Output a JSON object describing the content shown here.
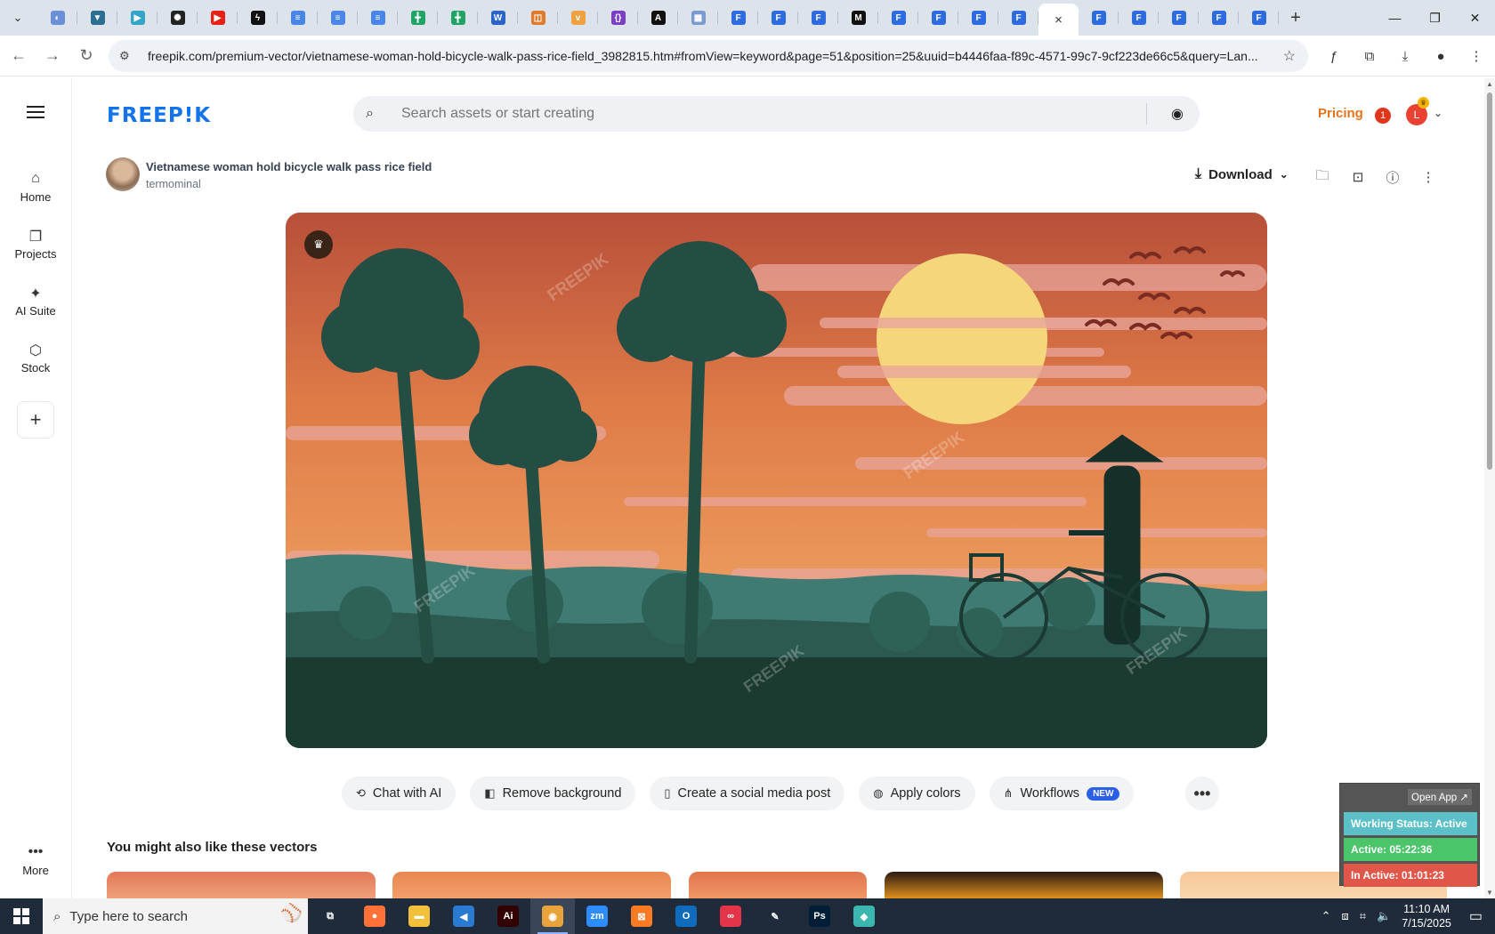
{
  "browser": {
    "active_tab_close": "×",
    "new_tab": "+",
    "url": "freepik.com/premium-vector/vietnamese-woman-hold-bicycle-walk-pass-rice-field_3982815.htm#fromView=keyword&page=51&position=25&uuid=b4446faa-f89c-4571-99c7-9cf223de66c5&query=Lan...",
    "tabs": [
      {
        "icon": "edge-like-icon",
        "color": "#6b8fd8",
        "glyph": "◐"
      },
      {
        "icon": "vpn-icon",
        "color": "#2c6e91",
        "glyph": "▼"
      },
      {
        "icon": "hex-icon",
        "color": "#35a4c9",
        "glyph": "▶"
      },
      {
        "icon": "chatgpt-icon",
        "color": "#222222",
        "glyph": "✺"
      },
      {
        "icon": "youtube-icon",
        "color": "#e62117",
        "glyph": "▶"
      },
      {
        "icon": "bolt-icon",
        "color": "#111111",
        "glyph": "ϟ"
      },
      {
        "icon": "docs-icon",
        "color": "#4a86e8",
        "glyph": "≡"
      },
      {
        "icon": "docs-icon",
        "color": "#4a86e8",
        "glyph": "≡"
      },
      {
        "icon": "docs-icon",
        "color": "#4a86e8",
        "glyph": "≡"
      },
      {
        "icon": "sheets-icon",
        "color": "#1fa463",
        "glyph": "╋"
      },
      {
        "icon": "sheets-icon",
        "color": "#1fa463",
        "glyph": "╋"
      },
      {
        "icon": "word-icon",
        "color": "#2b65c9",
        "glyph": "W"
      },
      {
        "icon": "orange-icon",
        "color": "#e07a2c",
        "glyph": "◫"
      },
      {
        "icon": "bird-icon",
        "color": "#f0a040",
        "glyph": "v"
      },
      {
        "icon": "braces-icon",
        "color": "#7a3fc4",
        "glyph": "{}"
      },
      {
        "icon": "a-icon",
        "color": "#111111",
        "glyph": "A"
      },
      {
        "icon": "grid-icon",
        "color": "#7a9ad0",
        "glyph": "▦"
      },
      {
        "icon": "forms-icon",
        "color": "#2d6cdf",
        "glyph": "F"
      },
      {
        "icon": "forms-icon",
        "color": "#2d6cdf",
        "glyph": "F"
      },
      {
        "icon": "forms-icon",
        "color": "#2d6cdf",
        "glyph": "F"
      },
      {
        "icon": "m-icon",
        "color": "#111111",
        "glyph": "M"
      },
      {
        "icon": "forms-icon",
        "color": "#2d6cdf",
        "glyph": "F"
      },
      {
        "icon": "forms-icon",
        "color": "#2d6cdf",
        "glyph": "F"
      },
      {
        "icon": "forms-icon",
        "color": "#2d6cdf",
        "glyph": "F"
      },
      {
        "icon": "forms-icon",
        "color": "#2d6cdf",
        "glyph": "F"
      }
    ],
    "tabs_after": [
      {
        "icon": "forms-icon",
        "color": "#2d6cdf",
        "glyph": "F"
      },
      {
        "icon": "forms-icon",
        "color": "#2d6cdf",
        "glyph": "F"
      },
      {
        "icon": "forms-icon",
        "color": "#2d6cdf",
        "glyph": "F"
      },
      {
        "icon": "forms-icon",
        "color": "#2d6cdf",
        "glyph": "F"
      },
      {
        "icon": "forms-icon",
        "color": "#2d6cdf",
        "glyph": "F"
      }
    ]
  },
  "nav": {
    "home": "Home",
    "projects": "Projects",
    "ai_suite": "AI Suite",
    "stock": "Stock",
    "more": "More"
  },
  "header": {
    "logo": "FREEP!K",
    "search_placeholder": "Search assets or start creating",
    "pricing": "Pricing",
    "notif_count": "1",
    "avatar_letter": "L"
  },
  "asset": {
    "title": "Vietnamese woman hold bicycle walk pass rice field",
    "author": "termominal",
    "download": "Download"
  },
  "actions": [
    {
      "label": "Chat with AI",
      "icon": "chat-ai-icon",
      "glyph": "⟲"
    },
    {
      "label": "Remove background",
      "icon": "remove-bg-icon",
      "glyph": "◧"
    },
    {
      "label": "Create a social media post",
      "icon": "phone-icon",
      "glyph": "▯"
    },
    {
      "label": "Apply colors",
      "icon": "palette-icon",
      "glyph": "◍"
    },
    {
      "label": "Workflows",
      "icon": "workflow-icon",
      "glyph": "⋔",
      "badge": "NEW"
    }
  ],
  "section_title": "You might also like these vectors",
  "tracker": {
    "open_app": "Open App ↗",
    "working_status": "Working Status: Active",
    "active": "Active: 05:22:36",
    "inactive": "In Active: 01:01:23",
    "colors": {
      "status": "#5bc0c8",
      "active": "#4cc46a",
      "inactive": "#e0574a"
    }
  },
  "taskbar": {
    "search_placeholder": "Type here to search",
    "time": "11:10 AM",
    "date": "7/15/2025",
    "apps": [
      {
        "name": "taskview-icon",
        "glyph": "⧉",
        "color": "transparent"
      },
      {
        "name": "firefox-icon",
        "glyph": "●",
        "color": "#ff7139"
      },
      {
        "name": "file-explorer-icon",
        "glyph": "▬",
        "color": "#f3c03b"
      },
      {
        "name": "vscode-icon",
        "glyph": "◀",
        "color": "#2a7ad2"
      },
      {
        "name": "illustrator-icon",
        "glyph": "Ai",
        "color": "#330000"
      },
      {
        "name": "chrome-icon",
        "glyph": "◉",
        "color": "#e8a33a"
      },
      {
        "name": "zoom-icon",
        "glyph": "zm",
        "color": "#2d8cff"
      },
      {
        "name": "xampp-icon",
        "glyph": "⊠",
        "color": "#fb7a24"
      },
      {
        "name": "outlook-icon",
        "glyph": "O",
        "color": "#0f6cbd"
      },
      {
        "name": "creative-cloud-icon",
        "glyph": "∞",
        "color": "#e4344a"
      },
      {
        "name": "pen-icon",
        "glyph": "✎",
        "color": "transparent"
      },
      {
        "name": "photoshop-icon",
        "glyph": "Ps",
        "color": "#001e36"
      },
      {
        "name": "app-diamond-icon",
        "glyph": "◆",
        "color": "#3cb7b0"
      }
    ]
  }
}
